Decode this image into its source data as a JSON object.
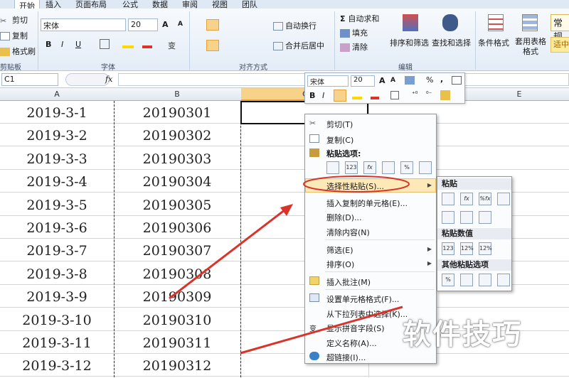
{
  "tabs": [
    "开始",
    "插入",
    "页面布局",
    "公式",
    "数据",
    "审阅",
    "视图",
    "团队"
  ],
  "clipboard": {
    "cut": "剪切",
    "copy": "复制",
    "painter": "格式刷",
    "group": "剪贴板"
  },
  "font": {
    "name": "宋体",
    "size": "20",
    "group": "字体",
    "bold": "B",
    "italic": "I",
    "underline": "U",
    "grow": "A",
    "shrink": "A"
  },
  "alignment": {
    "wrap": "自动换行",
    "merge": "合并后居中",
    "group": "对齐方式"
  },
  "editing": {
    "autosum": "自动求和",
    "fill": "填充",
    "clear": "清除",
    "sort": "排序和筛选",
    "find": "查找和选择",
    "group": "编辑"
  },
  "styles": {
    "cond": "条件格式",
    "table": "套用表格格式",
    "number_fmt": "常规",
    "accent": "适中"
  },
  "formula_bar": {
    "name_box": "C1",
    "fx": "fx",
    "value": ""
  },
  "columns": [
    "A",
    "B",
    "C",
    "E"
  ],
  "rows": [
    [
      "2019-3-1",
      "20190301"
    ],
    [
      "2019-3-2",
      "20190302"
    ],
    [
      "2019-3-3",
      "20190303"
    ],
    [
      "2019-3-4",
      "20190304"
    ],
    [
      "2019-3-5",
      "20190305"
    ],
    [
      "2019-3-6",
      "20190306"
    ],
    [
      "2019-3-7",
      "20190307"
    ],
    [
      "2019-3-8",
      "20190308"
    ],
    [
      "2019-3-9",
      "20190309"
    ],
    [
      "2019-3-10",
      "20190310"
    ],
    [
      "2019-3-11",
      "20190311"
    ],
    [
      "2019-3-12",
      "20190312"
    ]
  ],
  "mini_toolbar": {
    "font": "宋体",
    "size": "20",
    "bold": "B",
    "italic": "I",
    "percent": "%",
    "comma": ","
  },
  "context_menu": {
    "cut": "剪切(T)",
    "copy": "复制(C)",
    "paste_options": "粘贴选项:",
    "paste_icons": [
      "123",
      "fx",
      "%"
    ],
    "paste_special": "选择性粘贴(S)...",
    "insert_copied": "插入复制的单元格(E)...",
    "delete": "删除(D)...",
    "clear": "清除内容(N)",
    "filter": "筛选(E)",
    "sort": "排序(O)",
    "insert_comment": "插入批注(M)",
    "format_cells": "设置单元格格式(F)...",
    "pick_list": "从下拉列表中选择(K)...",
    "phonetic": "显示拼音字段(S)",
    "define_name": "定义名称(A)...",
    "hyperlink": "超链接(I)..."
  },
  "submenu": {
    "paste": "粘贴",
    "paste_values": "粘贴数值",
    "other": "其他粘贴选项",
    "icon_labels": [
      "fx",
      "%fx",
      "123",
      "12%",
      "12%"
    ]
  },
  "watermark": "软件技巧",
  "colors": {
    "accent": "#e3a33a",
    "annotation": "#d9332a",
    "ribbon": "#e3ecf7"
  }
}
